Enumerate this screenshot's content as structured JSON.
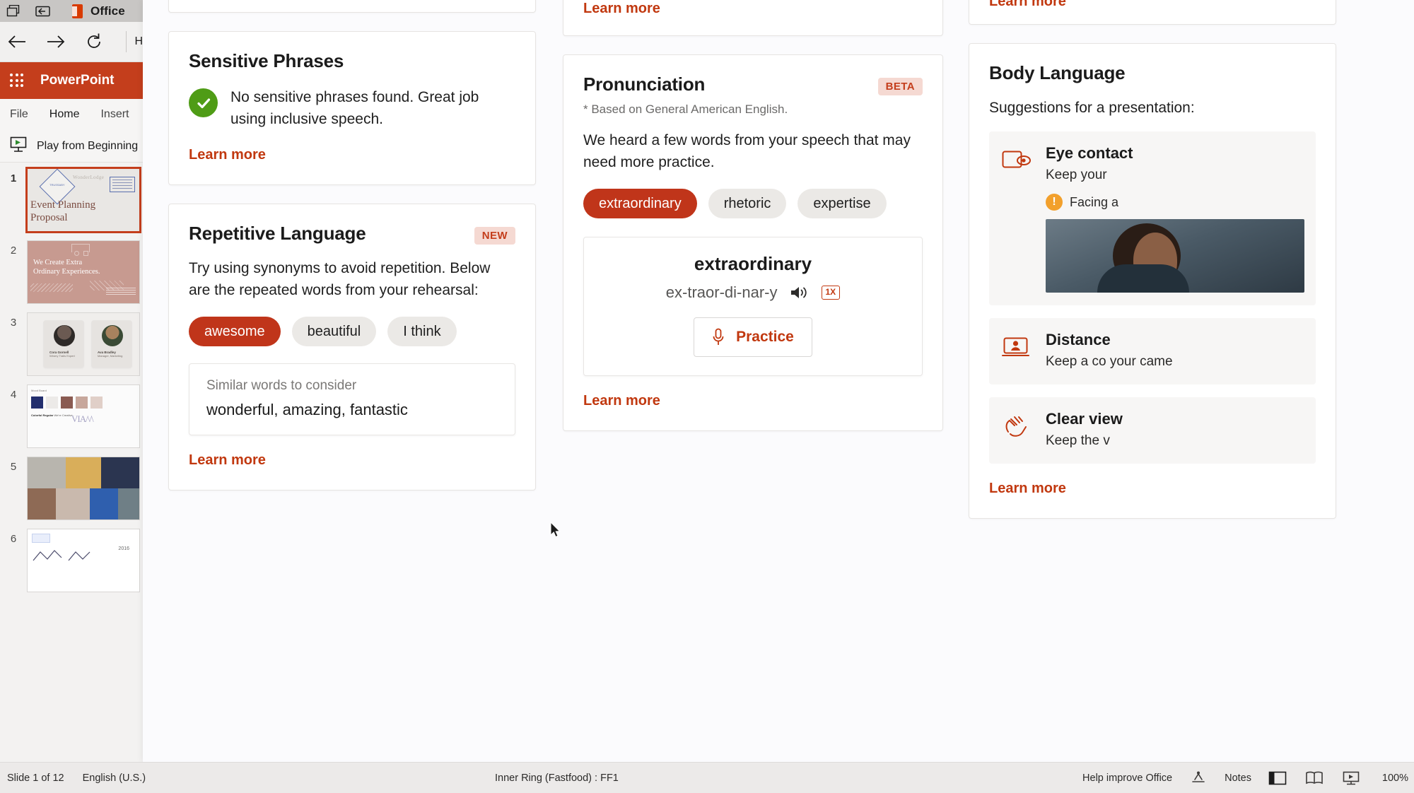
{
  "window": {
    "titlebar": {
      "office_label": "Office",
      "icons": [
        "tab-switcher-icon",
        "collapse-panel-icon",
        "office-logo-icon"
      ]
    },
    "nav": {
      "back": "back-arrow-icon",
      "forward": "forward-arrow-icon",
      "refresh": "refresh-icon",
      "truncated_text": "H"
    },
    "app_bar": {
      "app_name": "PowerPoint",
      "waffle": "app-launcher-icon"
    },
    "ribbon_tabs": [
      {
        "label": "File",
        "active": false
      },
      {
        "label": "Home",
        "active": true
      },
      {
        "label": "Insert",
        "active": false
      }
    ],
    "ribbon_row": {
      "play_label": "Play from Beginning",
      "icon": "present-screen-icon"
    }
  },
  "thumbnails": [
    {
      "num": "1",
      "selected": true,
      "title_line1": "Event Planning",
      "title_line2": "Proposal",
      "header_text": "WonderLodge",
      "label": "TRUSSABY"
    },
    {
      "num": "2",
      "selected": false,
      "line1": "We Create Extra",
      "line2": "Ordinary Experiences."
    },
    {
      "num": "3",
      "selected": false,
      "person1": "Cora Gornell",
      "person1role": "Winery Trails Expert",
      "person2": "Ava Bradley",
      "person2role": "Manager, Marketing"
    },
    {
      "num": "4",
      "selected": false,
      "heading": "Wanderlust",
      "sub": "We're Creative",
      "topline": "Mood Board",
      "wordmark": "VIA",
      "caption": "Colorful Regular"
    },
    {
      "num": "5",
      "selected": false
    },
    {
      "num": "6",
      "selected": false,
      "year": "2016"
    }
  ],
  "statusbar": {
    "slide_counter": "Slide 1 of 12",
    "language": "English (U.S.)",
    "center_text": "Inner Ring (Fastfood) : FF1",
    "help_text": "Help improve Office",
    "notes_label": "Notes",
    "zoom_level": "100%",
    "icons": [
      "accessibility-icon",
      "notes-icon",
      "normal-view-icon",
      "reading-view-icon",
      "slideshow-icon"
    ]
  },
  "coach": {
    "cards": {
      "partial_top_left": {
        "visible": false
      },
      "sensitive_phrases": {
        "title": "Sensitive Phrases",
        "status_icon": "check-circle-icon",
        "message": "No sensitive phrases found. Great job using inclusive speech.",
        "learn_more": "Learn more"
      },
      "repetitive_language": {
        "title": "Repetitive Language",
        "badge": "NEW",
        "body": "Try using synonyms to avoid repetition. Below are the repeated words from your rehearsal:",
        "words": [
          {
            "text": "awesome",
            "selected": true
          },
          {
            "text": "beautiful",
            "selected": false
          },
          {
            "text": "I think",
            "selected": false
          }
        ],
        "similar_label": "Similar words to consider",
        "similar_values": "wonderful, amazing, fantastic",
        "learn_more": "Learn more"
      },
      "partial_top_middle": {
        "learn_more": "Learn more"
      },
      "pronunciation": {
        "title": "Pronunciation",
        "badge": "BETA",
        "note": "* Based on General American English.",
        "body": "We heard a few words from your speech that may need more practice.",
        "words": [
          {
            "text": "extraordinary",
            "selected": true
          },
          {
            "text": "rhetoric",
            "selected": false
          },
          {
            "text": "expertise",
            "selected": false
          }
        ],
        "detail": {
          "word": "extraordinary",
          "syllables": "ex-traor-di-nar-y",
          "speaker_icon": "speaker-icon",
          "speed_badge": "1X",
          "practice_label": "Practice",
          "practice_icon": "microphone-icon"
        },
        "learn_more": "Learn more"
      },
      "partial_top_right": {
        "learn_more": "Learn more"
      },
      "body_language": {
        "title": "Body Language",
        "body": "Suggestions for a presentation:",
        "items": [
          {
            "icon": "eye-contact-icon",
            "title": "Eye contact",
            "desc": "Keep your",
            "warning": "Facing a",
            "has_photo": true
          },
          {
            "icon": "distance-icon",
            "title": "Distance",
            "desc": "Keep a co your came",
            "has_photo": false
          },
          {
            "icon": "clear-view-icon",
            "title": "Clear view",
            "desc": "Keep the v",
            "has_photo": false
          }
        ],
        "learn_more": "Learn more"
      }
    }
  },
  "colors": {
    "accent": "#c43e1c",
    "link": "#c1380f",
    "pill_selected_bg": "#c0351a",
    "pill_bg": "#ebe9e6",
    "success_green": "#4f9c16",
    "badge_bg": "#f5d9d2",
    "warning_orange": "#f2a02c"
  }
}
